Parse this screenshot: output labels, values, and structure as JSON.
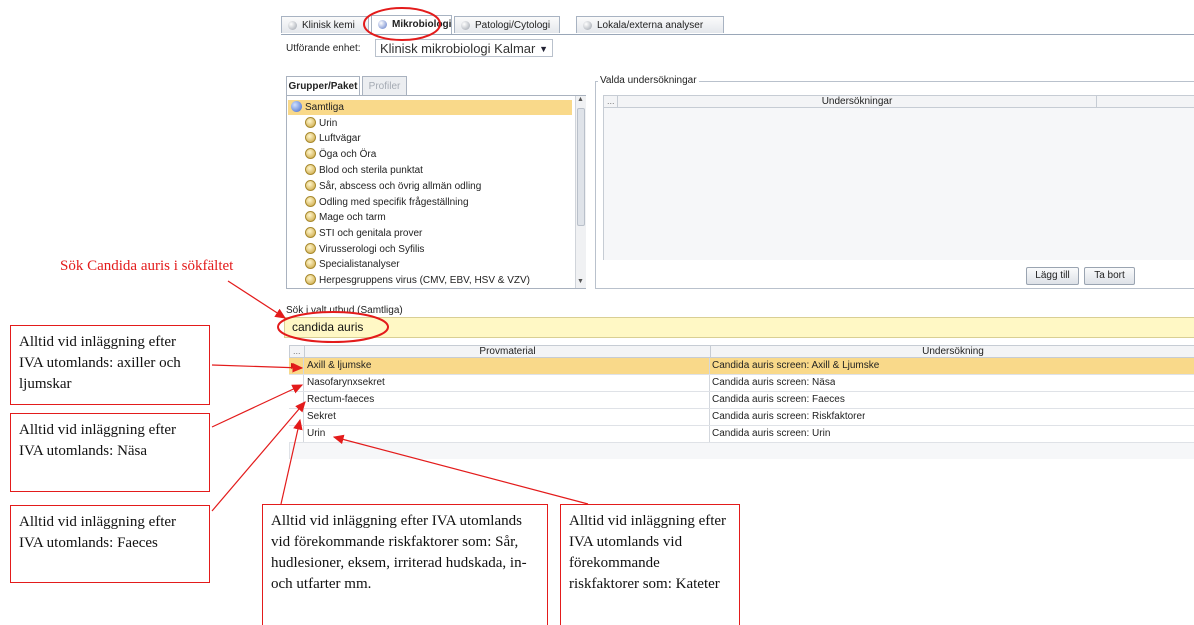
{
  "tabs": [
    {
      "label": "Klinisk kemi",
      "active": false
    },
    {
      "label": "Mikrobiologi",
      "active": true
    },
    {
      "label": "Patologi/Cytologi",
      "active": false
    },
    {
      "label": "Lokala/externa analyser",
      "active": false
    }
  ],
  "unit": {
    "label": "Utförande enhet:",
    "value": "Klinisk mikrobiologi Kalmar"
  },
  "group_tabs": {
    "groups": "Grupper/Paket",
    "profiles": "Profiler"
  },
  "tree": {
    "root": "Samtliga",
    "items": [
      "Urin",
      "Luftvägar",
      "Öga och Öra",
      "Blod och sterila punktat",
      "Sår, abscess och övrig allmän odling",
      "Odling med specifik frågeställning",
      "Mage och tarm",
      "STI och genitala prover",
      "Virusserologi och Syfilis",
      "Specialistanalyser",
      "Herpesgruppens virus (CMV, EBV, HSV & VZV)"
    ]
  },
  "selected_panel": {
    "legend": "Valda undersökningar",
    "corner": "...",
    "column": "Undersökningar",
    "add_button": "Lägg till",
    "remove_button": "Ta bort"
  },
  "search": {
    "label": "Sök i valt utbud (Samtliga)",
    "value": "candida auris"
  },
  "results": {
    "corner": "...",
    "columns": [
      "Provmaterial",
      "Undersökning"
    ],
    "rows": [
      {
        "material": "Axill & ljumske",
        "test": "Candida auris screen: Axill & Ljumske",
        "selected": true
      },
      {
        "material": "Nasofarynxsekret",
        "test": "Candida auris screen: Näsa",
        "selected": false
      },
      {
        "material": "Rectum-faeces",
        "test": "Candida auris screen: Faeces",
        "selected": false
      },
      {
        "material": "Sekret",
        "test": "Candida auris screen: Riskfaktorer",
        "selected": false
      },
      {
        "material": "Urin",
        "test": "Candida auris screen: Urin",
        "selected": false
      }
    ]
  },
  "annotations": {
    "search_hint": "Sök Candida auris i sökfältet",
    "box_axiller": "Alltid vid inläggning efter IVA utomlands: axiller och ljumskar",
    "box_nasa": "Alltid vid inläggning efter IVA utomlands: Näsa",
    "box_faeces": "Alltid vid inläggning efter IVA utomlands: Faeces",
    "box_sekret": "Alltid vid inläggning efter IVA utomlands vid förekommande riskfaktorer som: Sår, hudlesioner, eksem, irriterad hudskada, in- och utfarter mm.",
    "box_urin": "Alltid vid inläggning efter IVA utomlands vid förekommande riskfaktorer som: Kateter"
  },
  "colors": {
    "accent_red": "#e31b1b",
    "selection": "#f9d98a",
    "search_bg": "#fff8c5"
  }
}
